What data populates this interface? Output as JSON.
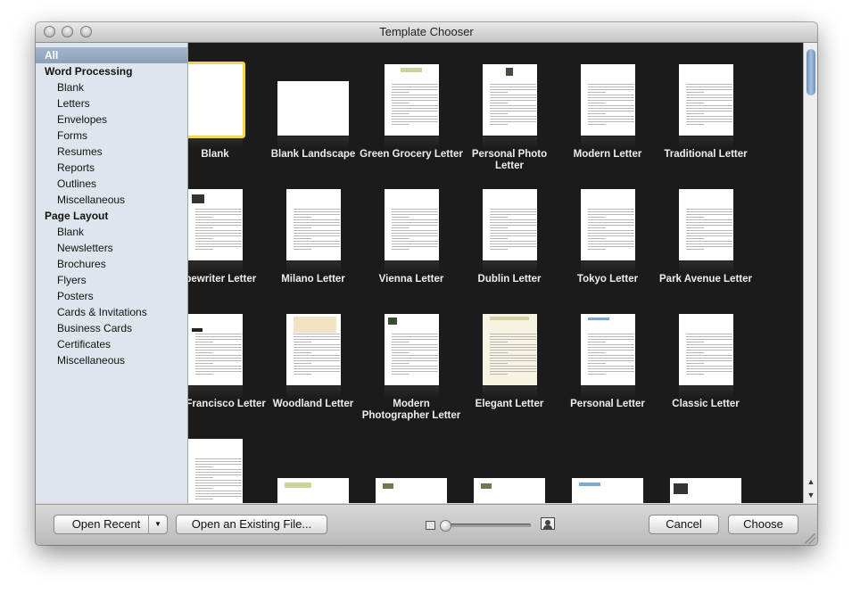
{
  "window": {
    "title": "Template Chooser"
  },
  "sidebar": {
    "items": [
      {
        "label": "All",
        "level": 0,
        "selected": true
      },
      {
        "label": "Word Processing",
        "level": 0,
        "header": true
      },
      {
        "label": "Blank",
        "level": 1
      },
      {
        "label": "Letters",
        "level": 1
      },
      {
        "label": "Envelopes",
        "level": 1
      },
      {
        "label": "Forms",
        "level": 1
      },
      {
        "label": "Resumes",
        "level": 1
      },
      {
        "label": "Reports",
        "level": 1
      },
      {
        "label": "Outlines",
        "level": 1
      },
      {
        "label": "Miscellaneous",
        "level": 1
      },
      {
        "label": "Page Layout",
        "level": 0,
        "header": true
      },
      {
        "label": "Blank",
        "level": 1
      },
      {
        "label": "Newsletters",
        "level": 1
      },
      {
        "label": "Brochures",
        "level": 1
      },
      {
        "label": "Flyers",
        "level": 1
      },
      {
        "label": "Posters",
        "level": 1
      },
      {
        "label": "Cards & Invitations",
        "level": 1
      },
      {
        "label": "Business Cards",
        "level": 1
      },
      {
        "label": "Certificates",
        "level": 1
      },
      {
        "label": "Miscellaneous",
        "level": 1
      }
    ]
  },
  "templates": [
    {
      "label": "Blank",
      "style": "blank",
      "selected": true
    },
    {
      "label": "Blank Landscape",
      "style": "landscape"
    },
    {
      "label": "Green Grocery Letter",
      "style": "green"
    },
    {
      "label": "Personal Photo Letter",
      "style": "photo"
    },
    {
      "label": "Modern Letter",
      "style": "letter"
    },
    {
      "label": "Traditional Letter",
      "style": "letter"
    },
    {
      "label": "Typewriter Letter",
      "style": "typewriter"
    },
    {
      "label": "Milano Letter",
      "style": "letter"
    },
    {
      "label": "Vienna Letter",
      "style": "letter"
    },
    {
      "label": "Dublin Letter",
      "style": "letter"
    },
    {
      "label": "Tokyo Letter",
      "style": "letter"
    },
    {
      "label": "Park Avenue Letter",
      "style": "letter"
    },
    {
      "label": "San Francisco Letter",
      "style": "sf"
    },
    {
      "label": "Woodland Letter",
      "style": "woodland"
    },
    {
      "label": "Modern Photographer Letter",
      "style": "photographer"
    },
    {
      "label": "Elegant Letter",
      "style": "elegant"
    },
    {
      "label": "Personal Letter",
      "style": "personal"
    },
    {
      "label": "Classic Letter",
      "style": "letter"
    },
    {
      "label": "",
      "style": "letter"
    },
    {
      "label": "",
      "style": "land-partial-green"
    },
    {
      "label": "",
      "style": "land-partial"
    },
    {
      "label": "",
      "style": "land-partial"
    },
    {
      "label": "",
      "style": "land-partial-blue"
    },
    {
      "label": "",
      "style": "land-partial-type"
    }
  ],
  "footer": {
    "open_recent": "Open Recent",
    "open_existing": "Open an Existing File...",
    "cancel": "Cancel",
    "choose": "Choose",
    "zoom_level": 0
  },
  "colors": {
    "selection": "#f2d453",
    "sidebar_bg": "#dfe5ec",
    "grid_bg": "#1b1b1b",
    "scroll_thumb": "#8aa7cc"
  }
}
